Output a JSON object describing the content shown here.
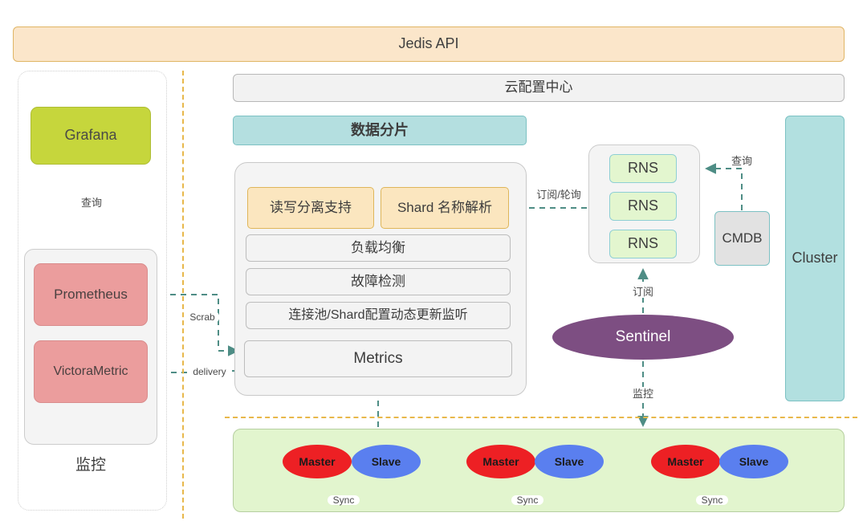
{
  "header": {
    "title": "Jedis API"
  },
  "left_panel": {
    "caption": "监控",
    "grafana": "Grafana",
    "prometheus": "Prometheus",
    "victorametric": "VictoraMetric",
    "edge_query": "查询"
  },
  "center": {
    "cloud_config": "云配置中心",
    "data_shard": "数据分片",
    "rw_split": "读写分离支持",
    "shard_resolve": "Shard 名称解析",
    "load_balance": "负载均衡",
    "fault_detect": "故障检测",
    "pool_listener": "连接池/Shard配置动态更新监听",
    "metrics": "Metrics"
  },
  "right": {
    "rns": [
      "RNS",
      "RNS",
      "RNS"
    ],
    "cmdb": "CMDB",
    "cluster": "Cluster",
    "sentinel": "Sentinel"
  },
  "replicas": [
    {
      "master": "Master",
      "slave": "Slave",
      "sync": "Sync"
    },
    {
      "master": "Master",
      "slave": "Slave",
      "sync": "Sync"
    },
    {
      "master": "Master",
      "slave": "Slave",
      "sync": "Sync"
    }
  ],
  "edges": {
    "scrab": "Scrab",
    "delivery": "delivery",
    "subscribe_poll": "订阅/轮询",
    "query_cmdb": "查询",
    "subscribe": "订阅",
    "monitor": "监控"
  },
  "colors": {
    "banner_fill": "#fbe6ca",
    "banner_border": "#e0b565",
    "grafana": "#c6d63c",
    "metric_red": "#eb9d9d",
    "teal": "#b2e0e0",
    "teal_border": "#7cc1c3",
    "amber_cell": "#fbe6bf",
    "amber_border": "#dfb65a",
    "rns_green": "#e3f6cf",
    "band_green": "#e2f5ce",
    "sentinel_purple": "#7d4e82",
    "master_red": "#ed2024",
    "slave_blue": "#5a7fef",
    "divider_amber": "#e8b84b",
    "arrow_teal": "#4e8d85"
  }
}
